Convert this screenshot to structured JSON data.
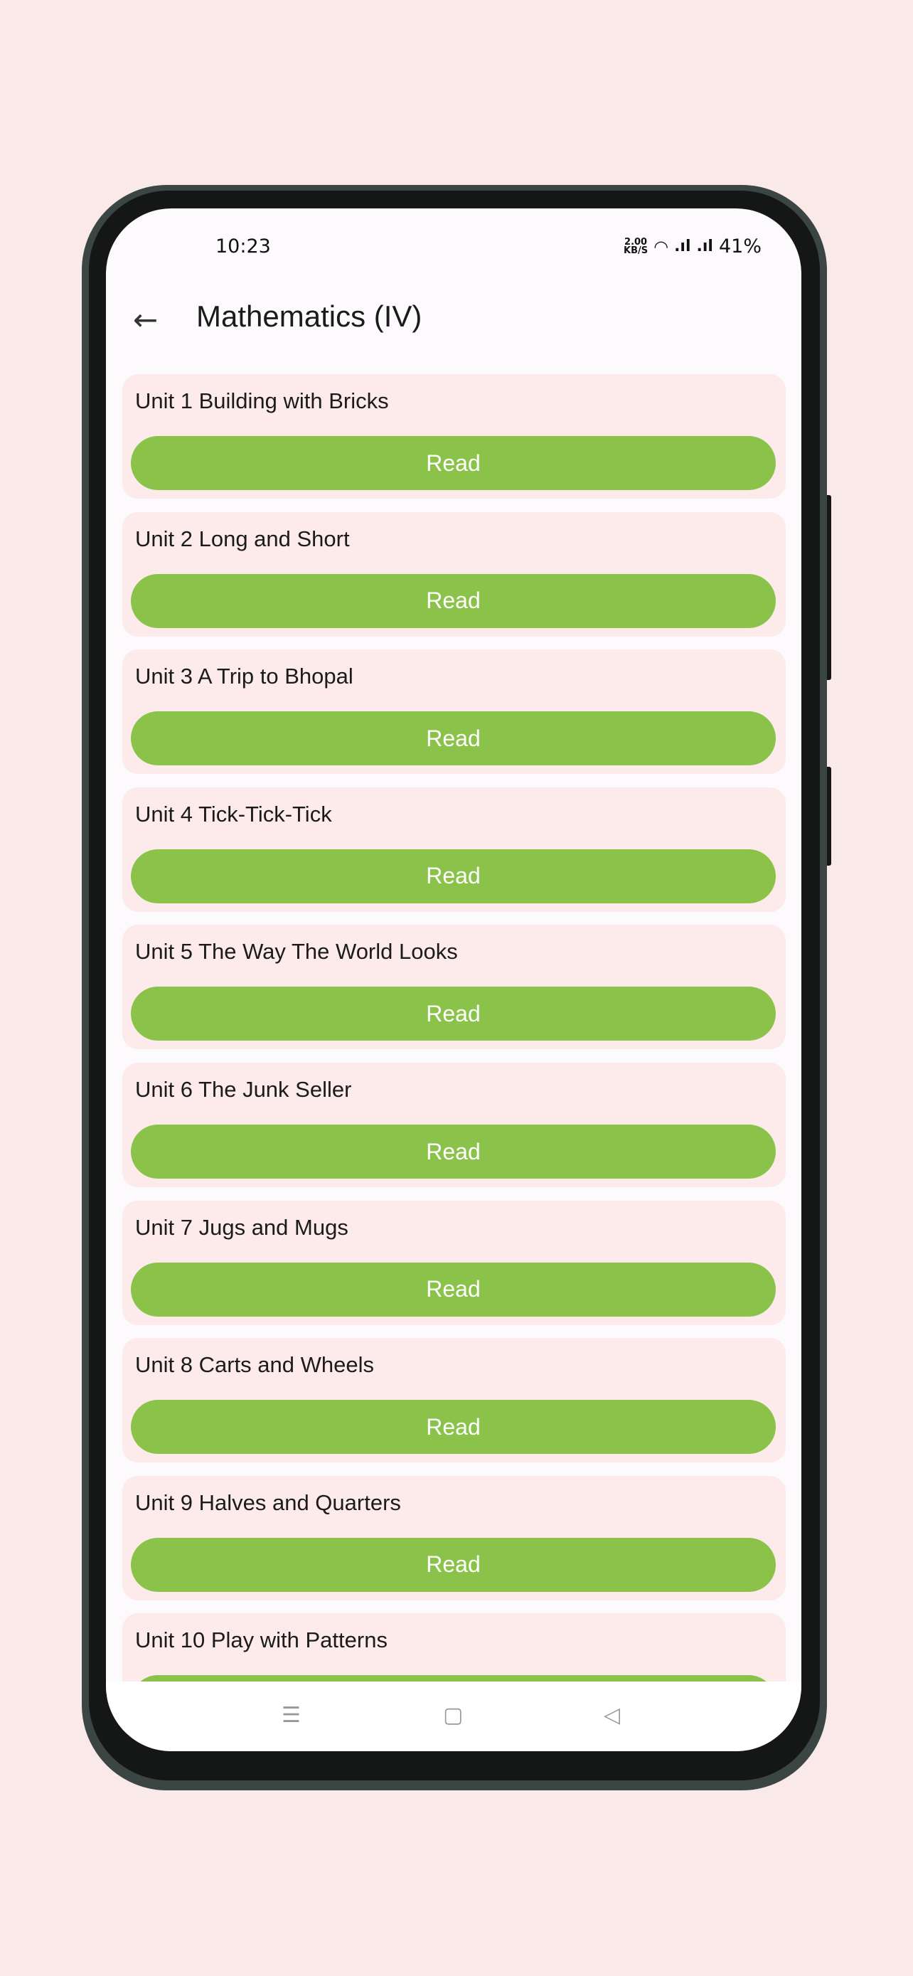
{
  "status": {
    "time": "10:23",
    "speed_value": "2.00",
    "speed_unit": "KB/S",
    "battery": "41%"
  },
  "header": {
    "title": "Mathematics (IV)"
  },
  "units": [
    {
      "label": "Unit 1  Building with Bricks",
      "button": "Read"
    },
    {
      "label": "Unit 2  Long and Short",
      "button": "Read"
    },
    {
      "label": "Unit 3  A Trip to Bhopal",
      "button": "Read"
    },
    {
      "label": "Unit 4  Tick-Tick-Tick",
      "button": "Read"
    },
    {
      "label": "Unit 5  The Way The World Looks",
      "button": "Read"
    },
    {
      "label": "Unit 6  The Junk Seller",
      "button": "Read"
    },
    {
      "label": "Unit 7  Jugs and Mugs",
      "button": "Read"
    },
    {
      "label": "Unit 8  Carts and Wheels",
      "button": "Read"
    },
    {
      "label": "Unit 9  Halves and Quarters",
      "button": "Read"
    },
    {
      "label": "Unit 10  Play with Patterns",
      "button": "Read"
    }
  ],
  "colors": {
    "accent": "#8bc34a",
    "card": "#fdebeb",
    "background": "#f9e9e8"
  }
}
